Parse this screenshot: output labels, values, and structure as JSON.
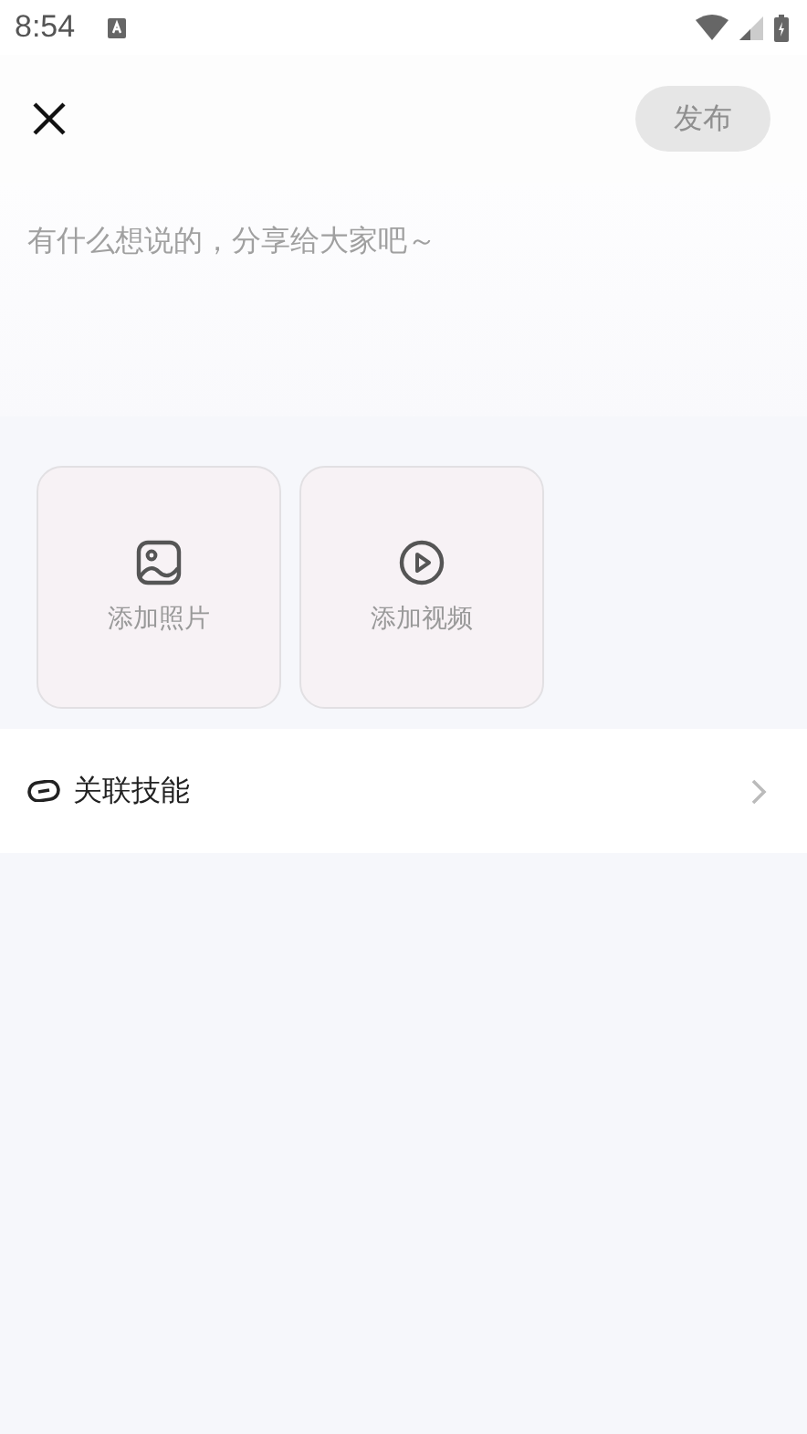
{
  "status_bar": {
    "time": "8:54"
  },
  "header": {
    "publish_button": {
      "label": "发布",
      "disabled": true
    }
  },
  "post_input": {
    "placeholder": "有什么想说的，分享给大家吧～"
  },
  "media_tiles": [
    {
      "kind": "photo",
      "label": "添加照片"
    },
    {
      "kind": "video",
      "label": "添加视频"
    }
  ],
  "link_row": {
    "label": "关联技能"
  }
}
